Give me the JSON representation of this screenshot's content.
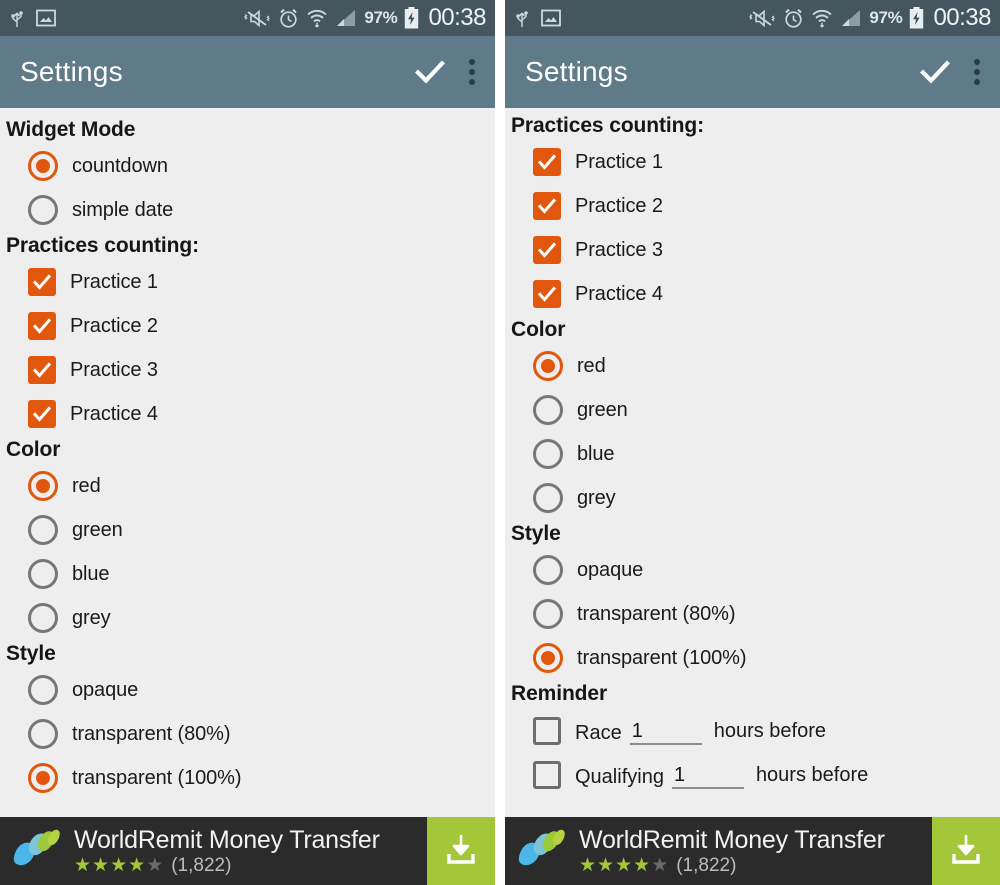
{
  "statusbar": {
    "icons_left": [
      "usb-icon",
      "screenshot-icon"
    ],
    "icons_right": [
      "vibrate-mute-icon",
      "alarm-icon",
      "wifi-icon",
      "signal-icon"
    ],
    "battery_percent": "97%",
    "battery_icon": "battery-charging-icon",
    "time": "00:38"
  },
  "actionbar": {
    "title": "Settings",
    "confirm_icon": "check-icon",
    "overflow_icon": "overflow-menu-icon"
  },
  "colors": {
    "accent": "#e2570e",
    "statusbar": "#45565f",
    "actionbar": "#5f7a89",
    "background": "#eeeeee",
    "ad_background": "#2b2b2b",
    "ad_cta": "#a4c639"
  },
  "left_screen": {
    "groups": [
      {
        "title": "Widget Mode",
        "type": "radio",
        "options": [
          {
            "label": "countdown",
            "selected": true
          },
          {
            "label": "simple date",
            "selected": false
          }
        ]
      },
      {
        "title": "Practices counting:",
        "type": "checkbox",
        "options": [
          {
            "label": "Practice 1",
            "checked": true
          },
          {
            "label": "Practice 2",
            "checked": true
          },
          {
            "label": "Practice 3",
            "checked": true
          },
          {
            "label": "Practice 4",
            "checked": true
          }
        ]
      },
      {
        "title": "Color",
        "type": "radio",
        "options": [
          {
            "label": "red",
            "selected": true
          },
          {
            "label": "green",
            "selected": false
          },
          {
            "label": "blue",
            "selected": false
          },
          {
            "label": "grey",
            "selected": false
          }
        ]
      },
      {
        "title": "Style",
        "type": "radio",
        "options": [
          {
            "label": "opaque",
            "selected": false
          },
          {
            "label": "transparent (80%)",
            "selected": false
          },
          {
            "label": "transparent (100%)",
            "selected": true
          }
        ]
      }
    ]
  },
  "right_screen": {
    "groups": [
      {
        "title": "Practices counting:",
        "type": "checkbox",
        "options": [
          {
            "label": "Practice 1",
            "checked": true
          },
          {
            "label": "Practice 2",
            "checked": true
          },
          {
            "label": "Practice 3",
            "checked": true
          },
          {
            "label": "Practice 4",
            "checked": true
          }
        ]
      },
      {
        "title": "Color",
        "type": "radio",
        "options": [
          {
            "label": "red",
            "selected": true
          },
          {
            "label": "green",
            "selected": false
          },
          {
            "label": "blue",
            "selected": false
          },
          {
            "label": "grey",
            "selected": false
          }
        ]
      },
      {
        "title": "Style",
        "type": "radio",
        "options": [
          {
            "label": "opaque",
            "selected": false
          },
          {
            "label": "transparent (80%)",
            "selected": false
          },
          {
            "label": "transparent (100%)",
            "selected": true
          }
        ]
      },
      {
        "title": "Reminder",
        "type": "reminder",
        "options": [
          {
            "label": "Race",
            "checked": false,
            "value": "1",
            "suffix": "hours before"
          },
          {
            "label": "Qualifying",
            "checked": false,
            "value": "1",
            "suffix": "hours before"
          }
        ]
      }
    ]
  },
  "ad": {
    "logo_icon": "worldremit-logo-icon",
    "title": "WorldRemit Money Transfer",
    "rating": 4,
    "rating_max": 5,
    "review_count": "(1,822)",
    "cta_icon": "download-icon"
  }
}
